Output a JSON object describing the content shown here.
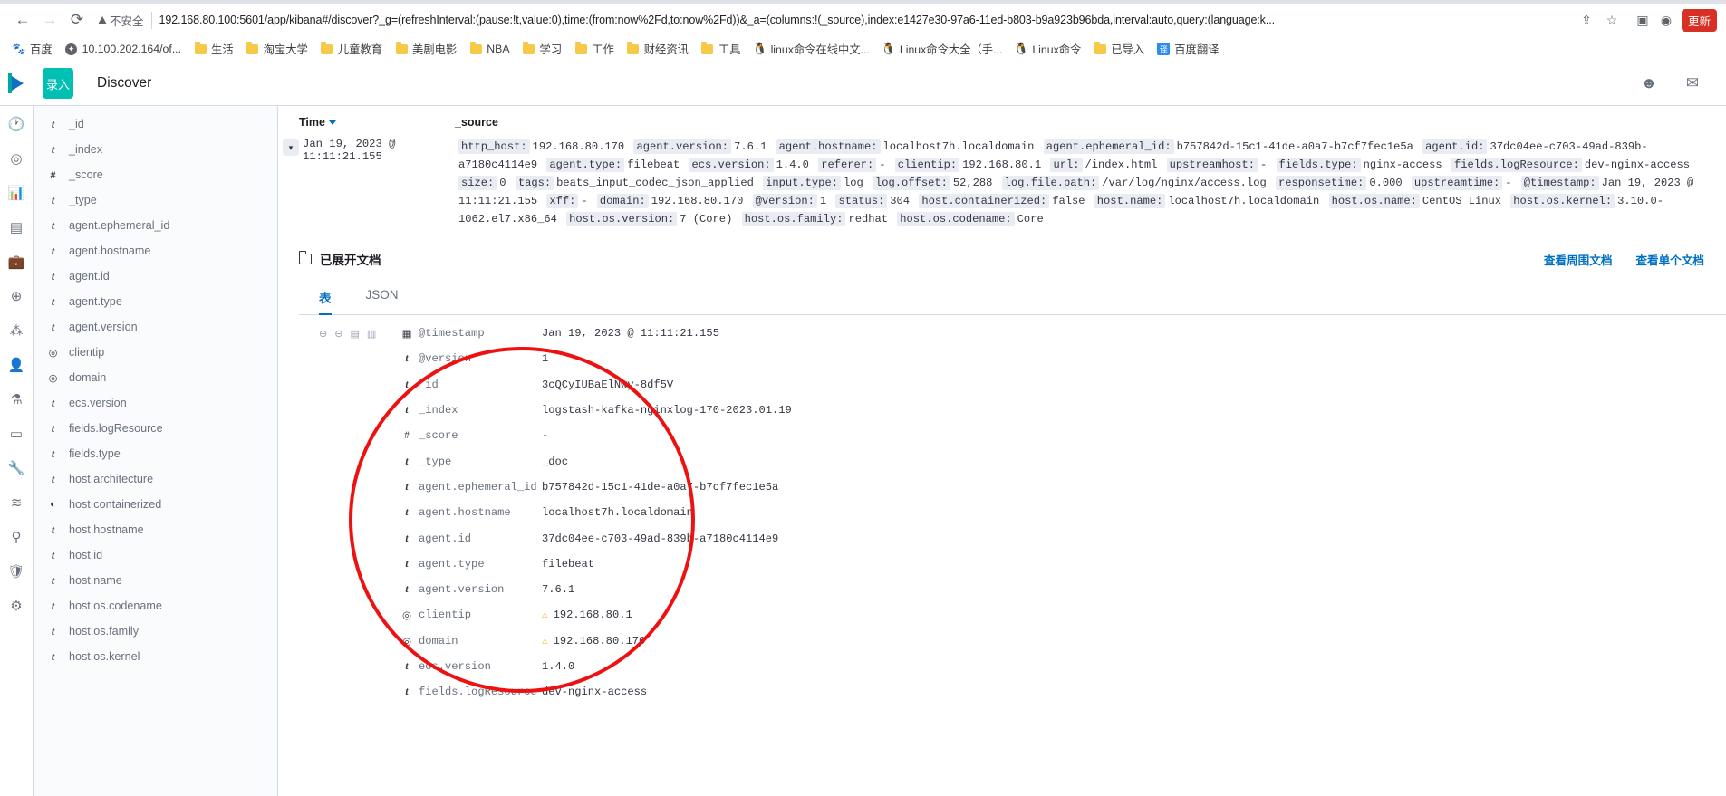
{
  "browser": {
    "nav": {
      "back": "←",
      "forward": "→",
      "reload": "⟳"
    },
    "security_label": "不安全",
    "url": "192.168.80.100:5601/app/kibana#/discover?_g=(refreshInterval:(pause:!t,value:0),time:(from:now%2Fd,to:now%2Fd))&_a=(columns:!(_source),index:e1427e30-97a6-11ed-b803-b9a923b96bda,interval:auto,query:(language:k...",
    "update_button": "更新",
    "bookmarks": [
      {
        "label": "百度",
        "icon": "baidu-icon"
      },
      {
        "label": "10.100.202.164/of...",
        "icon": "globe-icon"
      },
      {
        "label": "生活",
        "icon": "folder-icon"
      },
      {
        "label": "淘宝大学",
        "icon": "folder-icon"
      },
      {
        "label": "儿童教育",
        "icon": "folder-icon"
      },
      {
        "label": "美剧电影",
        "icon": "folder-icon"
      },
      {
        "label": "NBA",
        "icon": "folder-icon"
      },
      {
        "label": "学习",
        "icon": "folder-icon"
      },
      {
        "label": "工作",
        "icon": "folder-icon"
      },
      {
        "label": "财经资讯",
        "icon": "folder-icon"
      },
      {
        "label": "工具",
        "icon": "folder-icon"
      },
      {
        "label": "linux命令在线中文...",
        "icon": "tux-icon"
      },
      {
        "label": "Linux命令大全（手...",
        "icon": "tux-icon"
      },
      {
        "label": "Linux命令",
        "icon": "tux-icon"
      },
      {
        "label": "已导入",
        "icon": "folder-icon"
      },
      {
        "label": "百度翻译",
        "icon": "translate-icon"
      }
    ]
  },
  "kibana": {
    "app_title": "Discover",
    "logo_badge": "录入",
    "rail_icons": [
      "clock-icon",
      "compass-icon",
      "chart-icon",
      "layers-icon",
      "briefcase-icon",
      "globe-icon",
      "graph-icon",
      "user-icon",
      "beaker-icon",
      "monitor-icon",
      "wrench-icon",
      "signal-icon",
      "map-pin-icon",
      "shield-icon",
      "gear-icon"
    ],
    "header_right_icons": [
      "help-icon",
      "mail-icon"
    ],
    "fields": [
      {
        "type": "t",
        "name": "_id"
      },
      {
        "type": "t",
        "name": "_index"
      },
      {
        "type": "#",
        "name": "_score"
      },
      {
        "type": "t",
        "name": "_type"
      },
      {
        "type": "t",
        "name": "agent.ephemeral_id"
      },
      {
        "type": "t",
        "name": "agent.hostname"
      },
      {
        "type": "t",
        "name": "agent.id"
      },
      {
        "type": "t",
        "name": "agent.type"
      },
      {
        "type": "t",
        "name": "agent.version"
      },
      {
        "type": "ip",
        "name": "clientip"
      },
      {
        "type": "ip",
        "name": "domain"
      },
      {
        "type": "t",
        "name": "ecs.version"
      },
      {
        "type": "t",
        "name": "fields.logResource"
      },
      {
        "type": "t",
        "name": "fields.type"
      },
      {
        "type": "t",
        "name": "host.architecture"
      },
      {
        "type": "bool",
        "name": "host.containerized"
      },
      {
        "type": "t",
        "name": "host.hostname"
      },
      {
        "type": "t",
        "name": "host.id"
      },
      {
        "type": "t",
        "name": "host.name"
      },
      {
        "type": "t",
        "name": "host.os.codename"
      },
      {
        "type": "t",
        "name": "host.os.family"
      },
      {
        "type": "t",
        "name": "host.os.kernel"
      }
    ],
    "doc_table": {
      "col_time": "Time",
      "col_source": "_source",
      "row_time": "Jan 19, 2023 @ 11:11:21.155",
      "source_pairs": [
        {
          "k": "http_host:",
          "v": "192.168.80.170"
        },
        {
          "k": "agent.version:",
          "v": "7.6.1"
        },
        {
          "k": "agent.hostname:",
          "v": "localhost7h.localdomain"
        },
        {
          "k": "agent.ephemeral_id:",
          "v": "b757842d-15c1-41de-a0a7-b7cf7fec1e5a"
        },
        {
          "k": "agent.id:",
          "v": "37dc04ee-c703-49ad-839b-a7180c4114e9"
        },
        {
          "k": "agent.type:",
          "v": "filebeat"
        },
        {
          "k": "ecs.version:",
          "v": "1.4.0"
        },
        {
          "k": "referer:",
          "v": "-"
        },
        {
          "k": "clientip:",
          "v": "192.168.80.1"
        },
        {
          "k": "url:",
          "v": "/index.html"
        },
        {
          "k": "upstreamhost:",
          "v": "-"
        },
        {
          "k": "fields.type:",
          "v": "nginx-access"
        },
        {
          "k": "fields.logResource:",
          "v": "dev-nginx-access"
        },
        {
          "k": "size:",
          "v": "0"
        },
        {
          "k": "tags:",
          "v": "beats_input_codec_json_applied"
        },
        {
          "k": "input.type:",
          "v": "log"
        },
        {
          "k": "log.offset:",
          "v": "52,288"
        },
        {
          "k": "log.file.path:",
          "v": "/var/log/nginx/access.log"
        },
        {
          "k": "responsetime:",
          "v": "0.000"
        },
        {
          "k": "upstreamtime:",
          "v": "-"
        },
        {
          "k": "@timestamp:",
          "v": "Jan 19, 2023 @ 11:11:21.155"
        },
        {
          "k": "xff:",
          "v": "-"
        },
        {
          "k": "domain:",
          "v": "192.168.80.170"
        },
        {
          "k": "@version:",
          "v": "1"
        },
        {
          "k": "status:",
          "v": "304"
        },
        {
          "k": "host.containerized:",
          "v": "false"
        },
        {
          "k": "host.name:",
          "v": "localhost7h.localdomain"
        },
        {
          "k": "host.os.name:",
          "v": "CentOS Linux"
        },
        {
          "k": "host.os.kernel:",
          "v": "3.10.0-1062.el7.x86_64"
        },
        {
          "k": "host.os.version:",
          "v": "7 (Core)"
        },
        {
          "k": "host.os.family:",
          "v": "redhat"
        },
        {
          "k": "host.os.codename:",
          "v": "Core"
        }
      ]
    },
    "expanded": {
      "title": "已展开文档",
      "link_surrounding": "查看周围文档",
      "link_single": "查看单个文档",
      "tabs": [
        {
          "label": "表",
          "active": true
        },
        {
          "label": "JSON",
          "active": false
        }
      ],
      "rows": [
        {
          "type": "cal",
          "name": "@timestamp",
          "value": "Jan 19, 2023 @ 11:11:21.155",
          "warn": false
        },
        {
          "type": "t",
          "name": "@version",
          "value": "1",
          "warn": false
        },
        {
          "type": "t",
          "name": "_id",
          "value": "3cQCyIUBaElNwy-8df5V",
          "warn": false
        },
        {
          "type": "t",
          "name": "_index",
          "value": "logstash-kafka-nginxlog-170-2023.01.19",
          "warn": false
        },
        {
          "type": "#",
          "name": "_score",
          "value": "-",
          "warn": false
        },
        {
          "type": "t",
          "name": "_type",
          "value": "_doc",
          "warn": false
        },
        {
          "type": "t",
          "name": "agent.ephemeral_id",
          "value": "b757842d-15c1-41de-a0a7-b7cf7fec1e5a",
          "warn": false
        },
        {
          "type": "t",
          "name": "agent.hostname",
          "value": "localhost7h.localdomain",
          "warn": false
        },
        {
          "type": "t",
          "name": "agent.id",
          "value": "37dc04ee-c703-49ad-839b-a7180c4114e9",
          "warn": false
        },
        {
          "type": "t",
          "name": "agent.type",
          "value": "filebeat",
          "warn": false
        },
        {
          "type": "t",
          "name": "agent.version",
          "value": "7.6.1",
          "warn": false
        },
        {
          "type": "ip",
          "name": "clientip",
          "value": "192.168.80.1",
          "warn": true
        },
        {
          "type": "ip",
          "name": "domain",
          "value": "192.168.80.170",
          "warn": true
        },
        {
          "type": "t",
          "name": "ecs.version",
          "value": "1.4.0",
          "warn": false
        },
        {
          "type": "t",
          "name": "fields.logResource",
          "value": "dev-nginx-access",
          "warn": false
        }
      ]
    }
  }
}
